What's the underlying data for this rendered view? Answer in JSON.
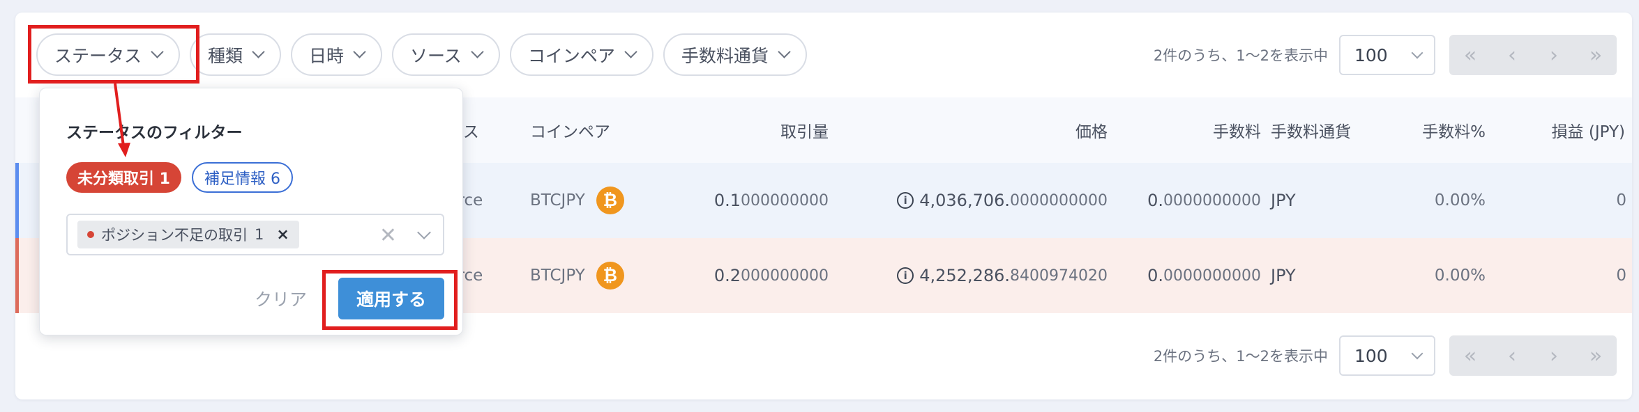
{
  "filters": [
    {
      "label": "ステータス"
    },
    {
      "label": "種類"
    },
    {
      "label": "日時"
    },
    {
      "label": "ソース"
    },
    {
      "label": "コインペア"
    },
    {
      "label": "手数料通貨"
    }
  ],
  "pagination": {
    "count_text": "2件のうち、1〜2を表示中",
    "page_size": "100",
    "first": "«",
    "prev": "‹",
    "next": "›",
    "last": "»"
  },
  "table": {
    "headers": {
      "source": "ース",
      "pair": "コインペア",
      "amount": "取引量",
      "price": "価格",
      "fee": "手数料",
      "fee_currency": "手数料通貨",
      "fee_pct": "手数料%",
      "pnl": "損益 (JPY)"
    },
    "rows": [
      {
        "source": "urce",
        "pair": "BTCJPY",
        "amount_main": "0.1",
        "amount_dec": "000000000",
        "price_main": "4,036,706.",
        "price_dec": "0000000000",
        "fee_main": "0.",
        "fee_dec": "0000000000",
        "fee_currency": "JPY",
        "fee_pct": "0.00%",
        "pnl": "0"
      },
      {
        "source": "urce",
        "pair": "BTCJPY",
        "amount_main": "0.2",
        "amount_dec": "000000000",
        "price_main": "4,252,286.",
        "price_dec": "8400974020",
        "fee_main": "0.",
        "fee_dec": "0000000000",
        "fee_currency": "JPY",
        "fee_pct": "0.00%",
        "pnl": "0"
      }
    ]
  },
  "popover": {
    "title": "ステータスのフィルター",
    "badge_unclassified": "未分類取引 1",
    "badge_supplement": "補足情報 6",
    "selected_tag": "ポジション不足の取引",
    "selected_tag_count": "1",
    "tag_remove": "×",
    "clear_symbol": "✕",
    "clear_label": "クリア",
    "apply_label": "適用する"
  },
  "coin_icon_glyph": "₿",
  "info_icon_glyph": "i",
  "colors": {
    "highlight": "#e11e1e",
    "apply_button": "#3e8fd8",
    "badge_red": "#d64536",
    "badge_blue": "#3b6fd6",
    "bitcoin": "#f0961e"
  }
}
